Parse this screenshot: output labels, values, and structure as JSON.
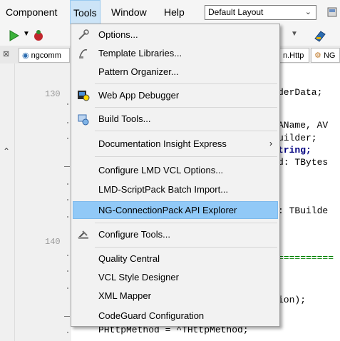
{
  "menubar": {
    "items": [
      "Component",
      "Tools",
      "Window",
      "Help"
    ],
    "layout_select": "Default Layout"
  },
  "tabs": [
    "ngcomm",
    "n.Http",
    "NG"
  ],
  "editor": {
    "line_numbers": [
      "130",
      "140"
    ],
    "code": [
      "derData;",
      "AName, AV",
      "uilder;",
      "tring;",
      "d: TBytes",
      ": TBuilde",
      "ion);",
      "PHttpMethod = ^THttpMethod;"
    ],
    "comment_line": "=========="
  },
  "tools_menu": {
    "items": [
      {
        "label": "Options...",
        "icon": "options-icon"
      },
      {
        "label": "Template Libraries...",
        "icon": "template-libraries-icon"
      },
      {
        "label": "Pattern Organizer...",
        "icon": ""
      },
      {
        "label": "Web App Debugger",
        "icon": "web-app-debugger-icon"
      },
      {
        "label": "Build Tools...",
        "icon": "build-tools-icon"
      },
      {
        "label": "Documentation Insight Express",
        "icon": "",
        "submenu": true
      },
      {
        "label": "Configure LMD VCL Options...",
        "icon": ""
      },
      {
        "label": "LMD-ScriptPack Batch Import...",
        "icon": ""
      },
      {
        "label": "NG-ConnectionPack API Explorer",
        "icon": "",
        "highlighted": true
      },
      {
        "label": "Configure Tools...",
        "icon": "configure-tools-icon"
      },
      {
        "label": "Quality Central",
        "icon": ""
      },
      {
        "label": "VCL Style Designer",
        "icon": ""
      },
      {
        "label": "XML Mapper",
        "icon": ""
      },
      {
        "label": "CodeGuard Configuration",
        "icon": ""
      }
    ],
    "submenu_arrow": "›"
  }
}
